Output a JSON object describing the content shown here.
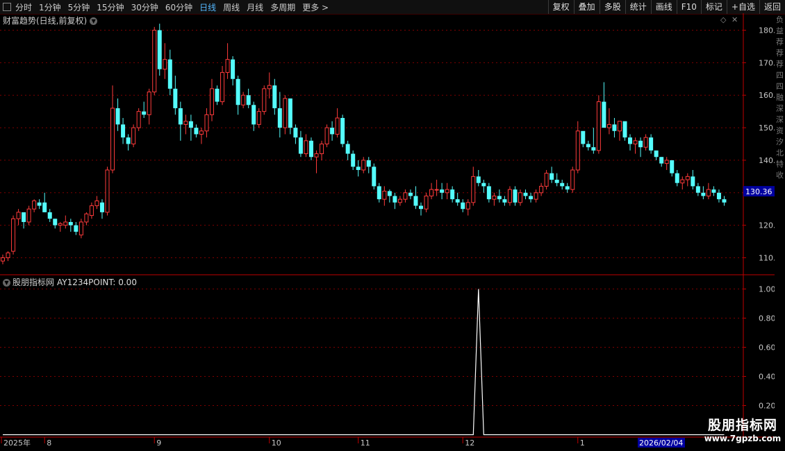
{
  "toolbar": {
    "periods": [
      "分时",
      "1分钟",
      "5分钟",
      "15分钟",
      "30分钟",
      "60分钟",
      "日线",
      "周线",
      "月线",
      "多周期",
      "更多 >"
    ],
    "active_period": "日线",
    "actions": [
      "复权",
      "叠加",
      "多股",
      "统计",
      "画线",
      "F10",
      "标记",
      "+自选",
      "返回"
    ]
  },
  "main_title": "财富趋势(日线,前复权)",
  "indicator_title": "股朋指标网",
  "indicator_value": "AY1234POINT: 0.00",
  "current_price_label": "130.36",
  "date_box_label": "2026/02/04",
  "side_strip_chars": [
    "负",
    "益",
    "荐",
    "荐",
    "荐",
    "四",
    "四",
    "融",
    "深",
    "深",
    "资",
    "汐",
    "北",
    "特",
    "收"
  ],
  "watermark": {
    "line1": "股朋指标网",
    "line2": "www.7gpzb.com"
  },
  "colors": {
    "up": "#ff3b3b",
    "down": "#54fcfc",
    "axis": "#c00000",
    "grid": "#800000",
    "text": "#c8c8c8",
    "line": "#ffffff",
    "price_box": "#0000a0"
  },
  "chart_data": [
    {
      "type": "candlestick",
      "title": "",
      "ylim": [
        105,
        183
      ],
      "yticks": [
        110,
        120,
        130,
        140,
        150,
        160,
        170,
        180
      ],
      "ytick_labels": [
        "110.0",
        "120.0",
        "130.0",
        "140.0",
        "150.0",
        "160.0",
        "170.0",
        "180.0"
      ],
      "x_labels": [
        {
          "label": "2025年",
          "index": 0
        },
        {
          "label": "8",
          "index": 8
        },
        {
          "label": "9",
          "index": 29
        },
        {
          "label": "10",
          "index": 51
        },
        {
          "label": "11",
          "index": 68
        },
        {
          "label": "12",
          "index": 88
        },
        {
          "label": "1",
          "index": 110
        }
      ],
      "last_price": 130.36,
      "candles": [
        [
          109,
          111,
          108,
          110
        ],
        [
          110,
          112,
          109,
          111.5
        ],
        [
          112,
          123,
          111,
          122
        ],
        [
          122,
          125,
          120,
          124
        ],
        [
          124,
          122,
          119,
          121
        ],
        [
          121,
          126,
          120,
          125
        ],
        [
          125,
          128,
          124,
          127.5
        ],
        [
          127,
          128,
          125,
          126
        ],
        [
          127,
          130,
          124,
          124
        ],
        [
          124,
          125,
          121,
          122
        ],
        [
          122,
          122,
          119,
          120
        ],
        [
          120,
          121,
          118,
          120.5
        ],
        [
          120,
          123,
          119,
          121
        ],
        [
          121,
          122,
          118,
          120
        ],
        [
          120,
          121,
          117,
          118
        ],
        [
          117,
          122,
          116,
          121
        ],
        [
          121,
          124,
          120,
          123.5
        ],
        [
          123,
          127,
          122,
          126
        ],
        [
          126,
          129,
          125,
          127.5
        ],
        [
          127,
          128,
          122,
          124
        ],
        [
          124,
          138,
          123,
          137
        ],
        [
          137,
          163,
          136,
          156
        ],
        [
          156,
          159,
          149,
          151
        ],
        [
          151,
          153,
          145,
          147
        ],
        [
          147,
          148,
          143,
          145
        ],
        [
          145,
          151,
          144,
          150
        ],
        [
          150,
          156,
          149,
          155
        ],
        [
          155,
          158,
          153,
          154
        ],
        [
          154,
          162,
          151,
          161
        ],
        [
          161,
          181,
          160,
          180
        ],
        [
          180,
          182,
          166,
          168
        ],
        [
          168,
          176,
          165,
          171
        ],
        [
          171,
          174,
          160,
          162
        ],
        [
          162,
          166,
          154,
          156
        ],
        [
          156,
          158,
          146,
          151
        ],
        [
          151,
          154,
          148,
          152
        ],
        [
          152,
          154,
          146,
          150
        ],
        [
          150,
          151,
          147,
          148
        ],
        [
          148,
          150,
          145,
          149
        ],
        [
          149,
          156,
          147,
          154
        ],
        [
          154,
          165,
          152,
          162
        ],
        [
          162,
          163,
          157,
          158
        ],
        [
          158,
          169,
          157,
          167
        ],
        [
          167,
          176,
          165,
          171
        ],
        [
          171,
          172,
          163,
          165
        ],
        [
          165,
          166,
          154,
          157
        ],
        [
          157,
          161,
          156,
          160
        ],
        [
          160,
          162,
          156,
          157
        ],
        [
          157,
          158,
          149,
          151
        ],
        [
          151,
          156,
          150,
          155
        ],
        [
          155,
          163,
          154,
          162
        ],
        [
          162,
          167,
          159,
          163
        ],
        [
          163,
          165,
          154,
          156
        ],
        [
          156,
          161,
          147,
          150
        ],
        [
          150,
          160,
          148,
          159
        ],
        [
          159,
          155,
          148,
          150
        ],
        [
          150,
          151,
          145,
          147
        ],
        [
          147,
          149,
          141,
          142
        ],
        [
          142,
          148,
          141,
          146
        ],
        [
          146,
          147,
          140,
          141
        ],
        [
          141,
          143,
          136,
          142
        ],
        [
          142,
          146,
          140,
          145
        ],
        [
          145,
          151,
          144,
          150
        ],
        [
          150,
          152,
          146,
          148
        ],
        [
          148,
          156,
          147,
          153
        ],
        [
          153,
          154,
          144,
          145
        ],
        [
          145,
          146,
          140,
          142
        ],
        [
          142,
          143,
          137,
          138
        ],
        [
          138,
          140,
          135,
          137
        ],
        [
          137,
          141,
          136,
          140
        ],
        [
          140,
          141,
          136,
          138
        ],
        [
          138,
          139,
          131,
          132
        ],
        [
          132,
          133,
          127,
          128
        ],
        [
          128,
          132,
          126,
          130.5
        ],
        [
          130.5,
          131,
          127,
          129
        ],
        [
          129,
          130,
          125,
          127
        ],
        [
          127,
          129,
          126,
          128
        ],
        [
          128,
          131,
          127,
          130
        ],
        [
          130,
          131,
          128,
          129
        ],
        [
          129,
          132,
          125,
          126
        ],
        [
          126,
          127,
          123,
          125
        ],
        [
          125,
          130,
          124,
          129
        ],
        [
          129,
          133,
          128,
          131
        ],
        [
          131,
          134,
          129,
          131
        ],
        [
          131,
          133,
          128,
          130
        ],
        [
          130,
          133,
          128,
          131
        ],
        [
          131,
          132,
          127,
          128
        ],
        [
          128,
          130,
          126,
          127
        ],
        [
          127,
          128,
          124,
          125
        ],
        [
          125,
          128,
          123,
          127
        ],
        [
          127,
          138,
          126,
          135
        ],
        [
          135,
          137,
          132,
          133
        ],
        [
          133,
          134,
          130,
          132
        ],
        [
          132,
          133,
          127,
          128
        ],
        [
          128,
          130,
          126,
          129
        ],
        [
          129,
          131,
          127,
          128
        ],
        [
          128,
          129,
          126,
          127
        ],
        [
          127,
          132,
          126,
          131
        ],
        [
          131,
          132,
          126,
          127
        ],
        [
          127,
          131,
          126,
          130
        ],
        [
          130,
          131,
          128,
          129
        ],
        [
          129,
          130,
          127,
          128
        ],
        [
          128,
          131,
          127,
          130
        ],
        [
          130,
          133,
          129,
          132
        ],
        [
          132,
          137,
          131,
          136
        ],
        [
          136,
          138,
          133,
          134
        ],
        [
          134,
          136,
          132,
          133
        ],
        [
          133,
          134,
          131,
          132
        ],
        [
          132,
          133,
          130,
          131
        ],
        [
          131,
          138,
          130,
          137
        ],
        [
          137,
          152,
          136,
          149
        ],
        [
          149,
          147,
          144,
          145
        ],
        [
          145,
          146,
          143,
          144
        ],
        [
          144,
          150,
          142,
          143
        ],
        [
          143,
          160,
          142,
          158
        ],
        [
          158,
          164,
          151,
          150
        ],
        [
          150,
          156,
          148,
          151
        ],
        [
          151,
          153,
          147,
          149
        ],
        [
          149,
          151,
          146,
          152
        ],
        [
          152,
          151,
          146,
          147
        ],
        [
          147,
          148,
          143,
          145
        ],
        [
          145,
          147,
          142,
          146
        ],
        [
          146,
          147,
          141,
          144
        ],
        [
          144,
          148,
          143,
          147
        ],
        [
          147,
          148,
          142,
          143
        ],
        [
          143,
          142,
          140,
          141
        ],
        [
          141,
          141,
          138,
          139
        ],
        [
          139,
          141,
          137,
          140
        ],
        [
          140,
          140,
          135,
          136
        ],
        [
          136,
          137,
          132,
          133
        ],
        [
          133,
          135,
          131,
          134
        ],
        [
          134,
          136,
          132,
          135
        ],
        [
          135,
          137,
          131,
          132
        ],
        [
          132,
          133,
          129,
          130
        ],
        [
          130,
          132,
          128,
          129
        ],
        [
          129,
          133,
          128,
          131
        ],
        [
          131,
          132,
          129,
          130
        ],
        [
          130,
          131,
          127,
          128
        ],
        [
          128,
          129,
          126,
          127
        ]
      ]
    },
    {
      "type": "line",
      "title": "",
      "name": "AY1234POINT",
      "ylim": [
        0.12,
        1.05
      ],
      "yticks": [
        0.2,
        0.4,
        0.6,
        0.8,
        1.0
      ],
      "ytick_labels": [
        "0.20",
        "0.40",
        "0.60",
        "0.80",
        "1.00"
      ],
      "x": [
        0,
        90,
        91,
        92,
        138
      ],
      "values": [
        0,
        0,
        1.0,
        0,
        0
      ]
    }
  ]
}
